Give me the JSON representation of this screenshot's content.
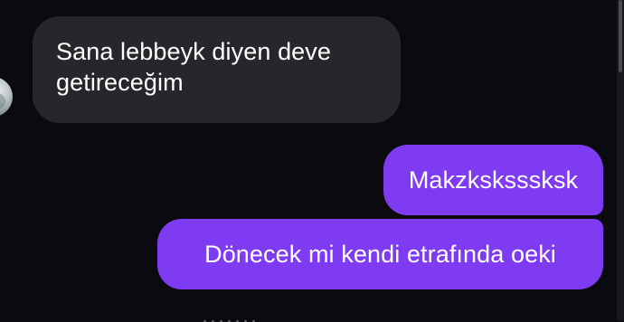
{
  "messages": {
    "received": {
      "lines": [
        "Sana lebbeyk diyen deve",
        "getireceğim"
      ]
    },
    "sent": [
      {
        "text": "Makzksksssksk"
      },
      {
        "text": "Dönecek mi kendi etrafında oeki"
      }
    ]
  },
  "colors": {
    "background": "#0b0b0f",
    "received_bubble": "#26272b",
    "sent_bubble": "#7e3bf1",
    "text": "#ffffff"
  },
  "icons": {
    "avatar": "contact-avatar-icon"
  }
}
